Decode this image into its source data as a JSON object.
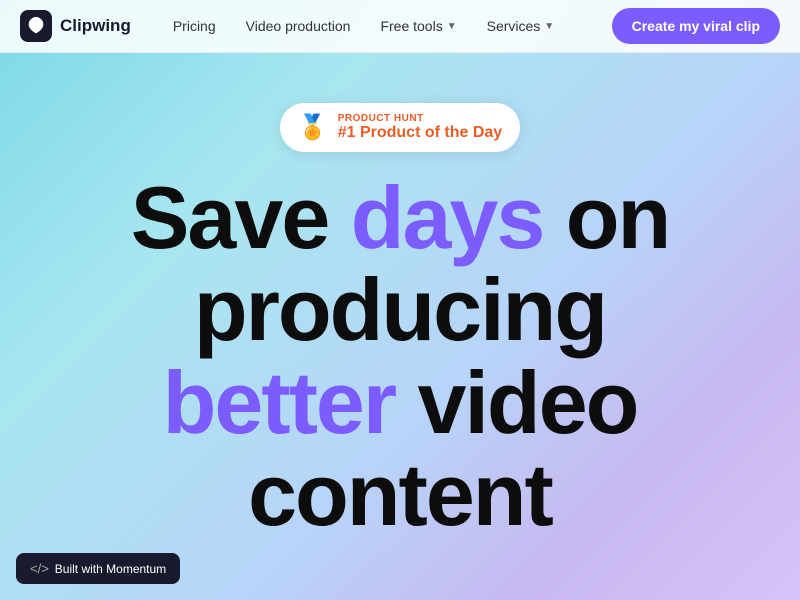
{
  "navbar": {
    "logo_name": "Clipwing",
    "links": [
      {
        "label": "Pricing",
        "has_dropdown": false
      },
      {
        "label": "Video production",
        "has_dropdown": false
      },
      {
        "label": "Free tools",
        "has_dropdown": true
      },
      {
        "label": "Services",
        "has_dropdown": true
      }
    ],
    "cta_label": "Create my viral clip"
  },
  "hero": {
    "ph_badge_label": "PRODUCT HUNT",
    "ph_badge_title": "#1 Product of the Day",
    "headline_line1_part1": "Save ",
    "headline_line1_highlight": "days",
    "headline_line1_part2": " on",
    "headline_line2": "producing",
    "headline_line3_highlight": "better",
    "headline_line3_part2": " video",
    "headline_line4": "content"
  },
  "footer_badge": {
    "label": "Built with Momentum"
  },
  "colors": {
    "purple": "#7c5cfc",
    "black": "#0d0d0d",
    "orange": "#e85d26",
    "dark": "#1a1a2e"
  }
}
